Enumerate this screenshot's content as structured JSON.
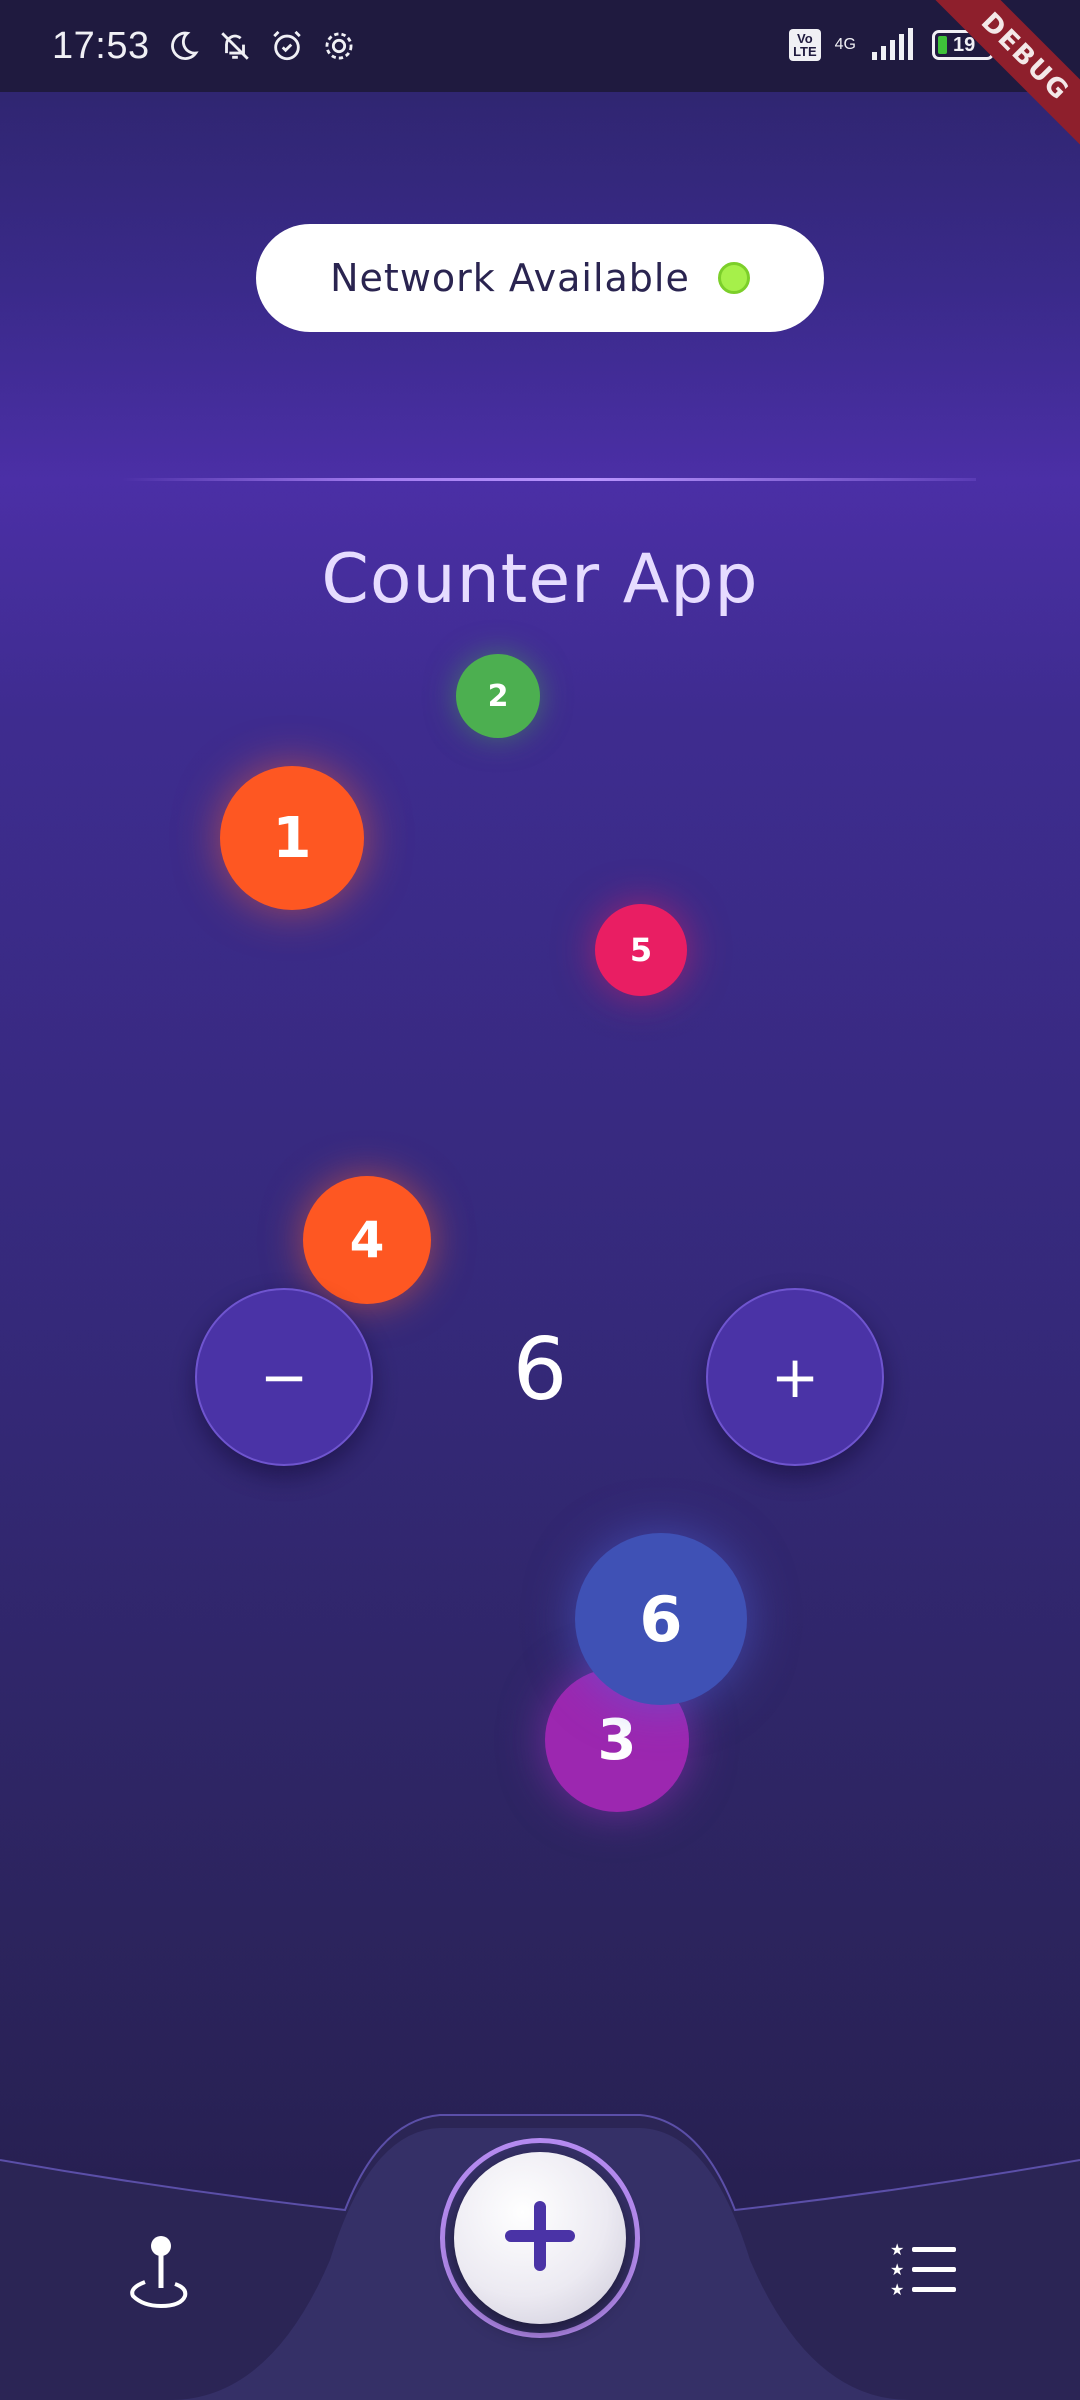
{
  "status_bar": {
    "time": "17:53",
    "left_icons": [
      "moon-icon",
      "bell-off-icon",
      "alarm-icon",
      "settings-icon"
    ],
    "volte_label": "Vo\nLTE",
    "network_type": "4G",
    "battery_level": "19"
  },
  "debug_banner": "DEBUG",
  "network_pill": {
    "label": "Network Available",
    "status_color": "#a6f04a"
  },
  "title": "Counter App",
  "bubbles": [
    {
      "label": "1",
      "color": "#fe5722"
    },
    {
      "label": "2",
      "color": "#4caf50"
    },
    {
      "label": "5",
      "color": "#e91e63"
    },
    {
      "label": "4",
      "color": "#fe5722"
    },
    {
      "label": "6",
      "color": "#3f51b5"
    },
    {
      "label": "3",
      "color": "#9c27b0"
    }
  ],
  "counter": {
    "decrement_label": "−",
    "value": "6",
    "increment_label": "+"
  },
  "bottom_nav": {
    "left_icon": "map-pin-icon",
    "center_icon": "plus-icon",
    "right_icon": "starred-list-icon"
  },
  "colors": {
    "accent": "#4a33a6",
    "fab_ring": "#b58bf0"
  }
}
